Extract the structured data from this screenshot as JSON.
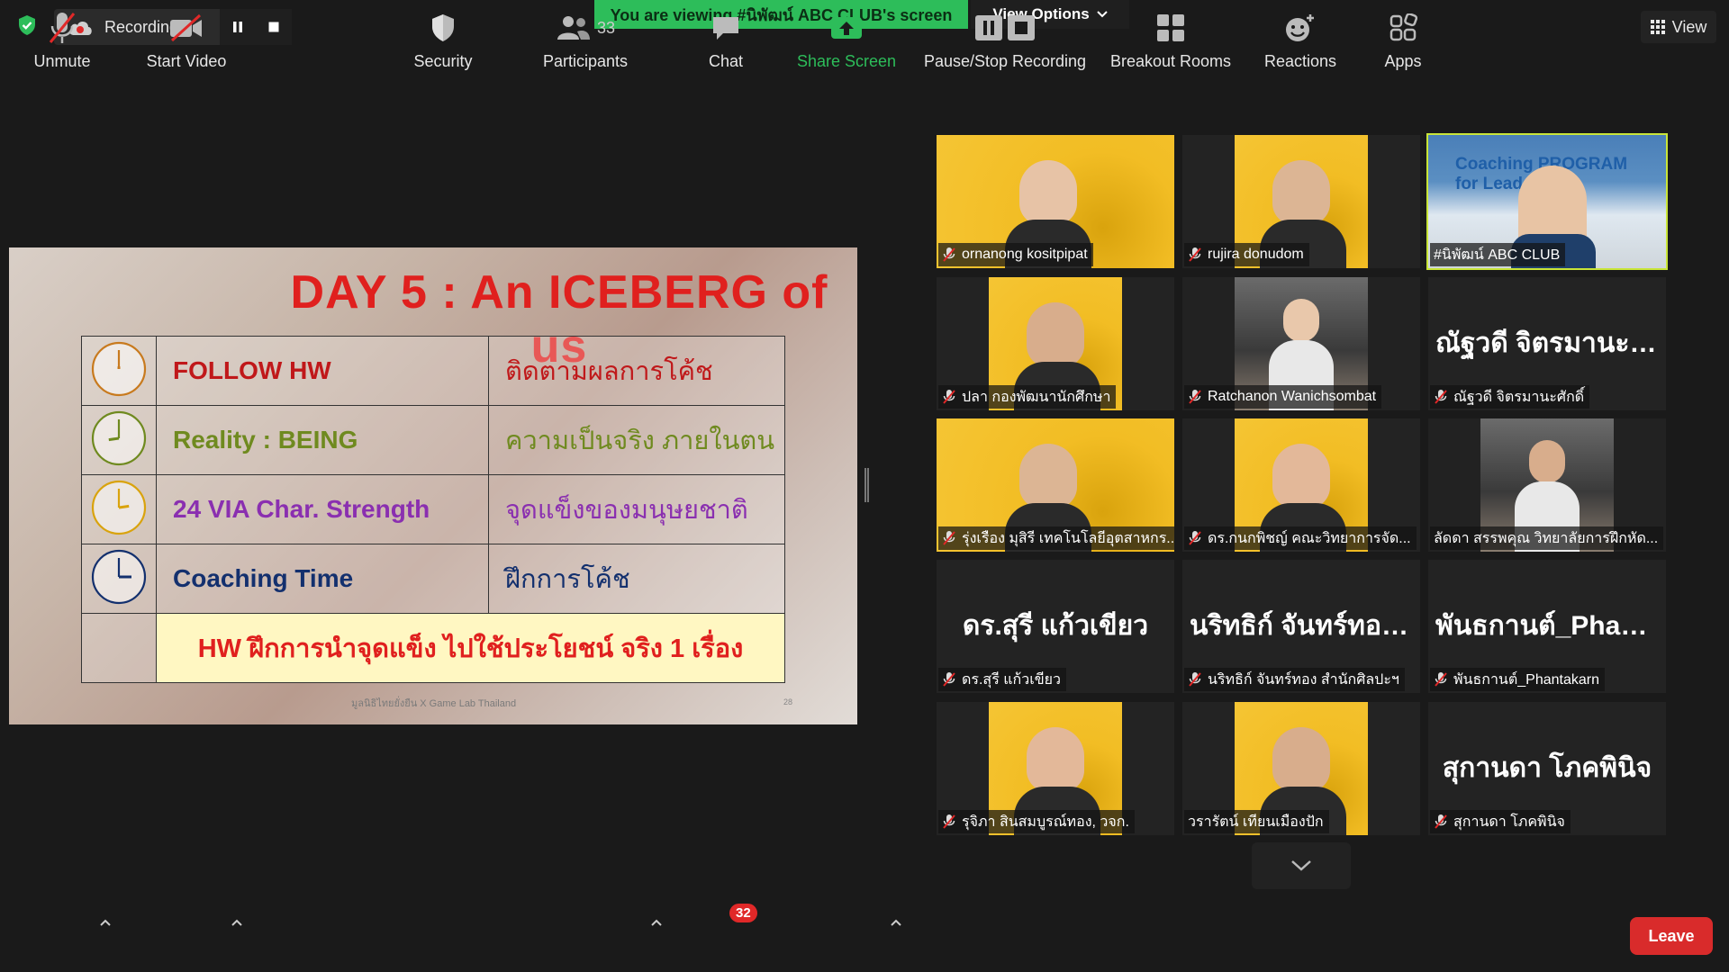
{
  "colors": {
    "banner_green": "#2dbd5a",
    "share_green": "#2dbd5a",
    "leave_red": "#d92b2b",
    "active_outline": "#c9e538",
    "slide_red": "#e0201e"
  },
  "topbar": {
    "recording_label": "Recording...",
    "viewing_banner": "You are viewing #นิพัฒน์ ABC CLUB's screen",
    "view_options": "View Options",
    "view_label": "View"
  },
  "slide": {
    "title": "DAY 5 : An ICEBERG of us",
    "rows": [
      {
        "en": "FOLLOW HW",
        "th": "ติดตามผลการโค้ช",
        "en_color": "#c0181a",
        "th_color": "#c0181a",
        "icon_color": "#c87a1e"
      },
      {
        "en": "Reality : BEING",
        "th": "ความเป็นจริง ภายในตน",
        "en_color": "#6f8a1f",
        "th_color": "#6f8a1f",
        "icon_color": "#6f8a1f"
      },
      {
        "en": "24 VIA Char. Strength",
        "th": "จุดแข็งของมนุษยชาติ",
        "en_color": "#8a2fb0",
        "th_color": "#8a2fb0",
        "icon_color": "#d9a30d"
      },
      {
        "en": "Coaching Time",
        "th": "ฝึกการโค้ช",
        "en_color": "#13306e",
        "th_color": "#13306e",
        "icon_color": "#13306e"
      }
    ],
    "hw": "HW ฝึกการนำจุดแข็ง ไปใช้ประโยชน์ จริง 1 เรื่อง",
    "footer": "มูลนิธิไทยยั่งยืน X Game Lab Thailand",
    "page": "28"
  },
  "participants": [
    {
      "name": "ornanong kositpipat",
      "kind": "video",
      "muted": true
    },
    {
      "name": "rujira donudom",
      "kind": "video",
      "muted": true
    },
    {
      "name": "#นิพัฒน์ ABC CLUB",
      "kind": "video",
      "muted": false,
      "active": true,
      "bg_text": "Coaching PROGRAM for Leader"
    },
    {
      "name": "ปลา กองพัฒนานักศึกษา",
      "kind": "video",
      "muted": true
    },
    {
      "name": "Ratchanon Wanichsombat",
      "kind": "video",
      "muted": true
    },
    {
      "name": "ณัฐวดี จิตรมานะศักดิ์",
      "kind": "name",
      "big": "ณัฐวดี จิตรมานะศั...",
      "muted": true
    },
    {
      "name": "รุ่งเรือง มุสิรี เทคโนโลยีอุตสาหกร...",
      "kind": "video",
      "muted": true
    },
    {
      "name": "ดร.กนกพิชญ์ คณะวิทยาการจัด...",
      "kind": "video",
      "muted": true
    },
    {
      "name": "ลัดดา สรรพคุณ วิทยาลัยการฝึกหัด...",
      "kind": "video",
      "muted": false
    },
    {
      "name": "ดร.สุรี แก้วเขียว",
      "kind": "name",
      "big": "ดร.สุรี แก้วเขียว",
      "muted": true
    },
    {
      "name": "นริทธิก์ จันทร์ทอง สำนักศิลปะฯ",
      "kind": "name",
      "big": "นริทธิก์ จันทร์ทอง...",
      "muted": true
    },
    {
      "name": "พันธกานต์_Phantakarn",
      "kind": "name",
      "big": "พันธกานต์_Phant...",
      "muted": true
    },
    {
      "name": "รุจิภา สินสมบูรณ์ทอง, วจก.",
      "kind": "video",
      "muted": true
    },
    {
      "name": "วรารัตน์ เทียนเมืองปัก",
      "kind": "video",
      "muted": false
    },
    {
      "name": "สุกานดา โภคพินิจ",
      "kind": "name",
      "big": "สุกานดา โภคพินิจ",
      "muted": true
    }
  ],
  "toolbar": {
    "unmute": "Unmute",
    "start_video": "Start Video",
    "security": "Security",
    "participants": "Participants",
    "participants_count": "33",
    "chat": "Chat",
    "chat_badge": "32",
    "share_screen": "Share Screen",
    "pause_stop": "Pause/Stop Recording",
    "breakout": "Breakout Rooms",
    "reactions": "Reactions",
    "apps": "Apps",
    "leave": "Leave"
  },
  "icons": [
    "shield-check-icon",
    "cloud-record-icon",
    "pause-icon",
    "stop-icon",
    "chevron-down-icon",
    "grid-icon",
    "clock-icon",
    "mic-muted-icon",
    "video-off-icon",
    "shield-icon",
    "people-icon",
    "chat-icon",
    "share-up-icon",
    "pause-stop-icon",
    "breakout-grid-icon",
    "smiley-plus-icon",
    "apps-icon",
    "caret-up-icon"
  ]
}
